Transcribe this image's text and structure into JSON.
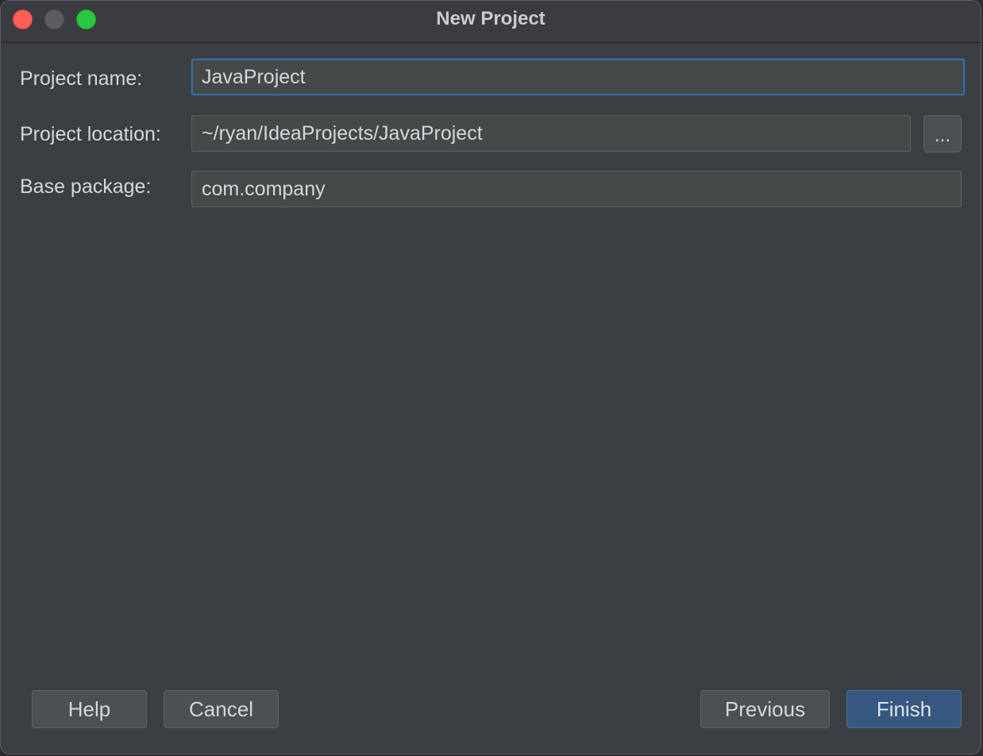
{
  "window": {
    "title": "New Project"
  },
  "form": {
    "project_name": {
      "label": "Project name:",
      "value": "JavaProject"
    },
    "project_location": {
      "label": "Project location:",
      "value": "~/ryan/IdeaProjects/JavaProject",
      "browse_label": "..."
    },
    "base_package": {
      "label": "Base package:",
      "value": "com.company"
    }
  },
  "buttons": {
    "help": "Help",
    "cancel": "Cancel",
    "previous": "Previous",
    "finish": "Finish"
  },
  "colors": {
    "background": "#3c3f41",
    "focus_border": "#3d6b9a",
    "primary_button": "#365880",
    "close": "#fe5f57",
    "zoom": "#28c840"
  }
}
